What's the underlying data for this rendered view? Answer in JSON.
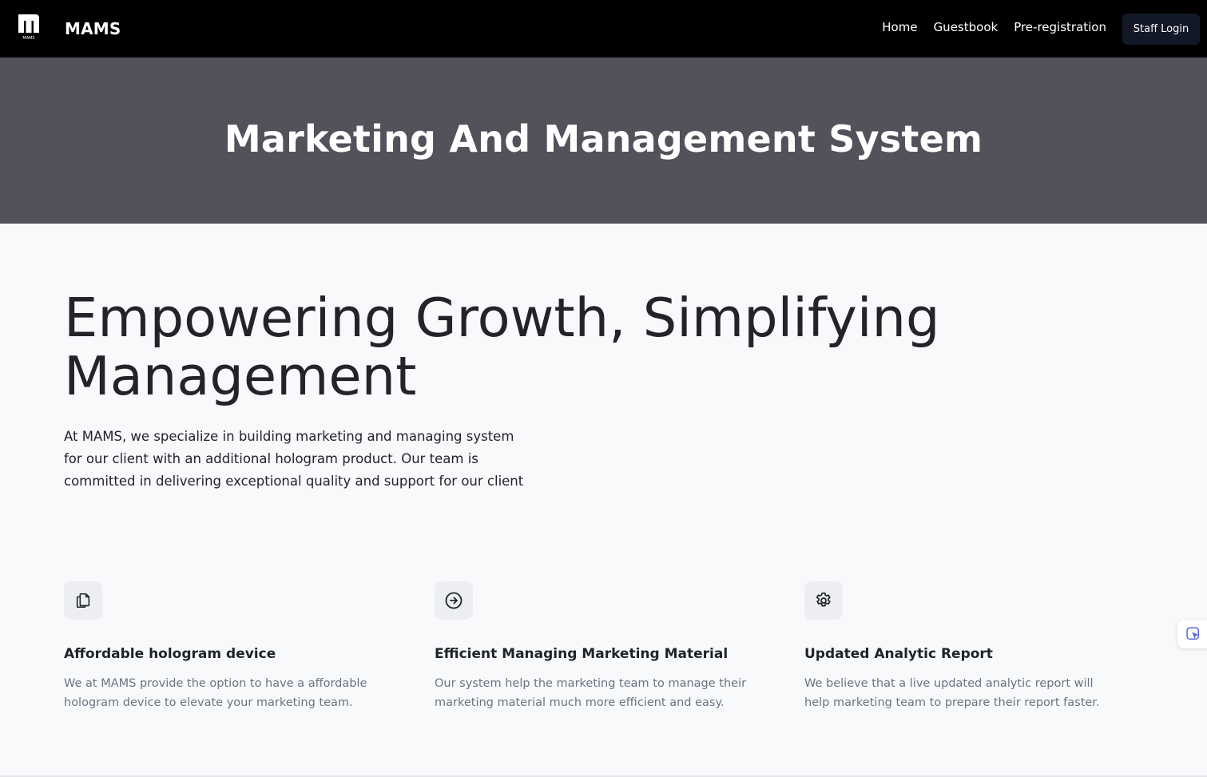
{
  "nav": {
    "logo_text": "MAMS",
    "brand": "MAMS",
    "links": [
      {
        "label": "Home"
      },
      {
        "label": "Guestbook"
      },
      {
        "label": "Pre-registration"
      }
    ],
    "staff_login_label": "Staff Login"
  },
  "hero": {
    "title": "Marketing And Management System"
  },
  "main": {
    "heading": "Empowering Growth, Simplifying Management",
    "intro": "At MAMS, we specialize in building marketing and managing system for our client with an additional hologram product. Our team is committed in delivering exceptional quality and support for our client"
  },
  "features": [
    {
      "icon": "documents-icon",
      "title": "Affordable hologram device",
      "description": "We at MAMS provide the option to have a affordable hologram device to elevate your marketing team."
    },
    {
      "icon": "arrow-circle-right-icon",
      "title": "Efficient Managing Marketing Material",
      "description": "Our system help the marketing team to manage their marketing material much more efficient and easy."
    },
    {
      "icon": "gear-icon",
      "title": "Updated Analytic Report",
      "description": "We believe that a live updated analytic report will help marketing team to prepare their report faster."
    }
  ],
  "colors": {
    "navbar_bg": "#000000",
    "hero_bg": "#52525b",
    "page_bg": "#f8f9fb",
    "button_bg": "#121826",
    "muted_text": "#6b7280"
  }
}
